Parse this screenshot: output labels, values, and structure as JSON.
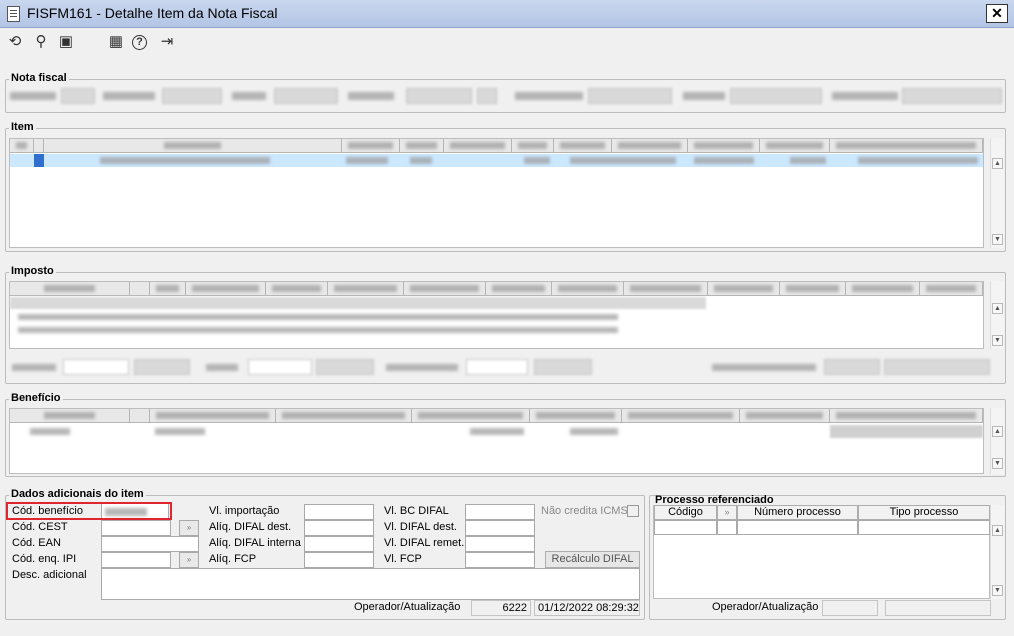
{
  "window": {
    "title": "FISFM161 - Detalhe Item da Nota Fiscal",
    "close_label": "✕"
  },
  "toolbar": {
    "undo": "⟲",
    "search": "⚲",
    "save": "▣",
    "calendar": "▦",
    "help": "?",
    "exit": "⇥"
  },
  "sections": {
    "nota_fiscal": "Nota fiscal",
    "item": "Item",
    "imposto": "Imposto",
    "beneficio": "Benefício",
    "dados_adicionais": "Dados adicionais do item",
    "processo_referenciado": "Processo referenciado"
  },
  "dados_adicionais": {
    "cod_beneficio_label": "Cód. benefício",
    "cod_cest_label": "Cód. CEST",
    "cod_ean_label": "Cód. EAN",
    "cod_enq_ipi_label": "Cód. enq. IPI",
    "desc_adicional_label": "Desc. adicional",
    "vl_importacao_label": "Vl. importação",
    "aliq_difal_dest_label": "Alíq. DIFAL dest.",
    "aliq_difal_interna_label": "Alíq. DIFAL interna",
    "aliq_fcp_label": "Alíq. FCP",
    "vl_bc_difal_label": "Vl. BC DIFAL",
    "vl_difal_dest_label": "Vl. DIFAL dest.",
    "vl_difal_remet_label": "Vl. DIFAL remet.",
    "vl_fcp_label": "Vl. FCP",
    "nao_credita_icms_label": "Não credita ICMS",
    "recalculo_difal_button": "Recálculo DIFAL",
    "operador_label": "Operador/Atualização",
    "operador_value": "6222",
    "atualizacao_value": "01/12/2022 08:29:32",
    "lookup_icon": "»"
  },
  "processo_referenciado": {
    "columns": [
      "Código",
      "",
      "Número processo",
      "Tipo processo"
    ],
    "operador_label": "Operador/Atualização"
  },
  "icons": {
    "scroll_up": "▲",
    "scroll_down": "▼"
  }
}
